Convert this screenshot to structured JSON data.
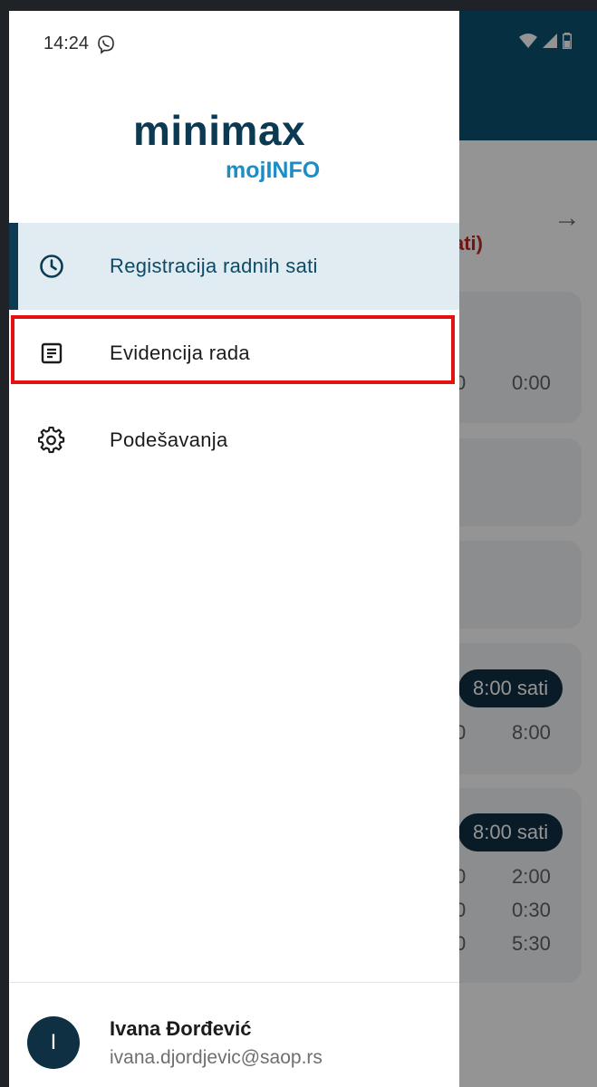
{
  "status_bar": {
    "time": "14:24"
  },
  "logo": {
    "main": "minimax",
    "sub": "mojINFO"
  },
  "menu": [
    {
      "label": "Registracija radnih sati",
      "icon": "clock-icon",
      "active": true
    },
    {
      "label": "Evidencija rada",
      "icon": "document-icon",
      "active": false
    },
    {
      "label": "Podešavanja",
      "icon": "gear-icon",
      "active": false
    }
  ],
  "user": {
    "initial": "I",
    "name": "Ivana Đorđević",
    "email": "ivana.djordjevic@saop.rs"
  },
  "background": {
    "subtitle_fragment": "ati)",
    "values": [
      "0",
      "0:00",
      "0",
      "8:00",
      "0",
      "2:00",
      "0",
      "0:30",
      "0",
      "5:30"
    ],
    "pills": [
      "8:00 sati",
      "8:00 sati"
    ]
  },
  "colors": {
    "accent": "#0c3a52",
    "brand_blue": "#1d8dc6",
    "highlight": "#e41111",
    "active_bg": "#e0ecf2"
  }
}
